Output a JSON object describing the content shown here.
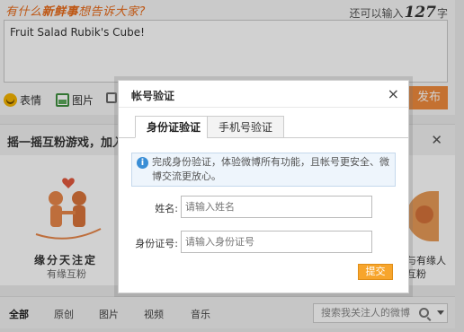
{
  "composer": {
    "prompt_prefix": "有什么",
    "prompt_highlight": "新鲜事",
    "prompt_suffix": "想告诉大家?",
    "counter_prefix": "还可以输入",
    "counter_value": "127",
    "counter_suffix": "字",
    "text_value": "Fruit Salad Rubik's Cube!",
    "tools": {
      "emoji": "表情",
      "image": "图片"
    },
    "publish_label": "发布"
  },
  "banner": {
    "title": "摇一摇互粉游戏，加入",
    "left_title": "缘分天注定",
    "left_sub": "有缘互粉",
    "right_line1": "与有缘人",
    "right_line2": "互粉"
  },
  "filterbar": {
    "tabs": [
      "全部",
      "原创",
      "图片",
      "视频",
      "音乐"
    ],
    "search_placeholder": "搜索我关注人的微博"
  },
  "modal": {
    "title": "帐号验证",
    "close": "×",
    "tabs": [
      "身份证验证",
      "手机号验证"
    ],
    "notice": "完成身份验证，体验微博所有功能，且帐号更安全、微博交流更放心。",
    "info_icon_glyph": "i",
    "name_label": "姓名:",
    "name_placeholder": "请输入姓名",
    "id_label": "身份证号:",
    "id_placeholder": "请输入身份证号",
    "submit_label": "提交"
  },
  "colors": {
    "accent_orange": "#f08a3c",
    "submit_orange": "#f7a52c",
    "notice_bg": "#eef5fc",
    "info_blue": "#3a8ed6"
  }
}
